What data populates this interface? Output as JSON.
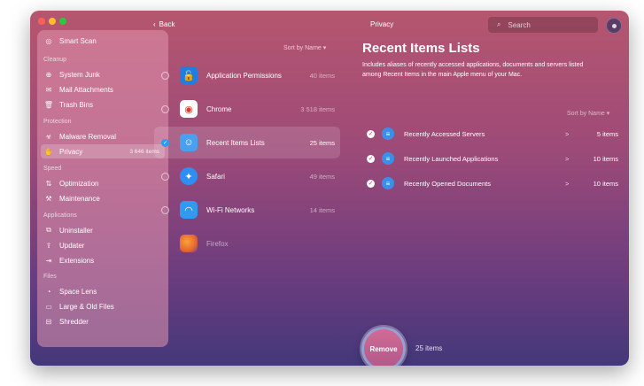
{
  "sidebar": {
    "items": [
      {
        "label": "Smart Scan",
        "icon": "smart-scan-icon",
        "glyph": "◎"
      },
      {
        "label": "System Junk",
        "icon": "system-junk-icon",
        "glyph": "⊕"
      },
      {
        "label": "Mail Attachments",
        "icon": "mail-icon",
        "glyph": "✉"
      },
      {
        "label": "Trash Bins",
        "icon": "trash-icon",
        "glyph": "🗑"
      },
      {
        "label": "Malware Removal",
        "icon": "biohazard-icon",
        "glyph": "☣"
      },
      {
        "label": "Privacy",
        "icon": "privacy-hand-icon",
        "glyph": "✋",
        "size": "3 646 items"
      },
      {
        "label": "Optimization",
        "icon": "sliders-icon",
        "glyph": "⇅"
      },
      {
        "label": "Maintenance",
        "icon": "wrench-icon",
        "glyph": "⚒"
      },
      {
        "label": "Uninstaller",
        "icon": "uninstaller-icon",
        "glyph": "⧉"
      },
      {
        "label": "Updater",
        "icon": "updater-icon",
        "glyph": "⇪"
      },
      {
        "label": "Extensions",
        "icon": "extensions-icon",
        "glyph": "⇥"
      },
      {
        "label": "Space Lens",
        "icon": "space-lens-icon",
        "glyph": "◔"
      },
      {
        "label": "Large & Old Files",
        "icon": "folder-icon",
        "glyph": "▭"
      },
      {
        "label": "Shredder",
        "icon": "shredder-icon",
        "glyph": "⊟"
      }
    ],
    "sections": {
      "cleanup": "Cleanup",
      "protection": "Protection",
      "speed": "Speed",
      "applications": "Applications",
      "files": "Files"
    }
  },
  "toolbar": {
    "back_label": "Back",
    "title": "Privacy",
    "search_placeholder": "Search"
  },
  "middle": {
    "sort_label": "Sort by Name ▾",
    "apps": [
      {
        "name": "Application Permissions",
        "count": "40 items",
        "icon_color": "#1f7ee0",
        "glyph": "🔓",
        "icon": "lock-icon"
      },
      {
        "name": "Chrome",
        "count": "3 518 items",
        "icon_color": "#ffffff",
        "glyph": "◉",
        "icon": "chrome-icon"
      },
      {
        "name": "Recent Items Lists",
        "count": "25 items",
        "icon_color": "#4aa0f0",
        "glyph": "☺",
        "icon": "finder-icon"
      },
      {
        "name": "Safari",
        "count": "49 items",
        "icon_color": "#2f8ef0",
        "glyph": "✦",
        "icon": "safari-icon"
      },
      {
        "name": "Wi-Fi Networks",
        "count": "14 items",
        "icon_color": "#2f9af0",
        "glyph": "◠",
        "icon": "wifi-icon"
      },
      {
        "name": "Firefox",
        "count": "",
        "icon_color": "#e8672a",
        "glyph": "●",
        "icon": "firefox-icon"
      }
    ]
  },
  "detail": {
    "title": "Recent Items Lists",
    "description": "Includes aliases of recently accessed applications, documents and servers listed among Recent Items in the main Apple menu of your Mac.",
    "sort_label": "Sort by Name ▾",
    "rows": [
      {
        "name": "Recently Accessed Servers",
        "chevron": ">",
        "count": "5 items"
      },
      {
        "name": "Recently Launched Applications",
        "chevron": ">",
        "count": "10 items"
      },
      {
        "name": "Recently Opened Documents",
        "chevron": ">",
        "count": "10 items"
      }
    ]
  },
  "footer": {
    "remove_label": "Remove",
    "remove_count": "25 items"
  },
  "colors": {
    "accent_blue": "#2d9cf0",
    "check_red": "#e0304a"
  }
}
